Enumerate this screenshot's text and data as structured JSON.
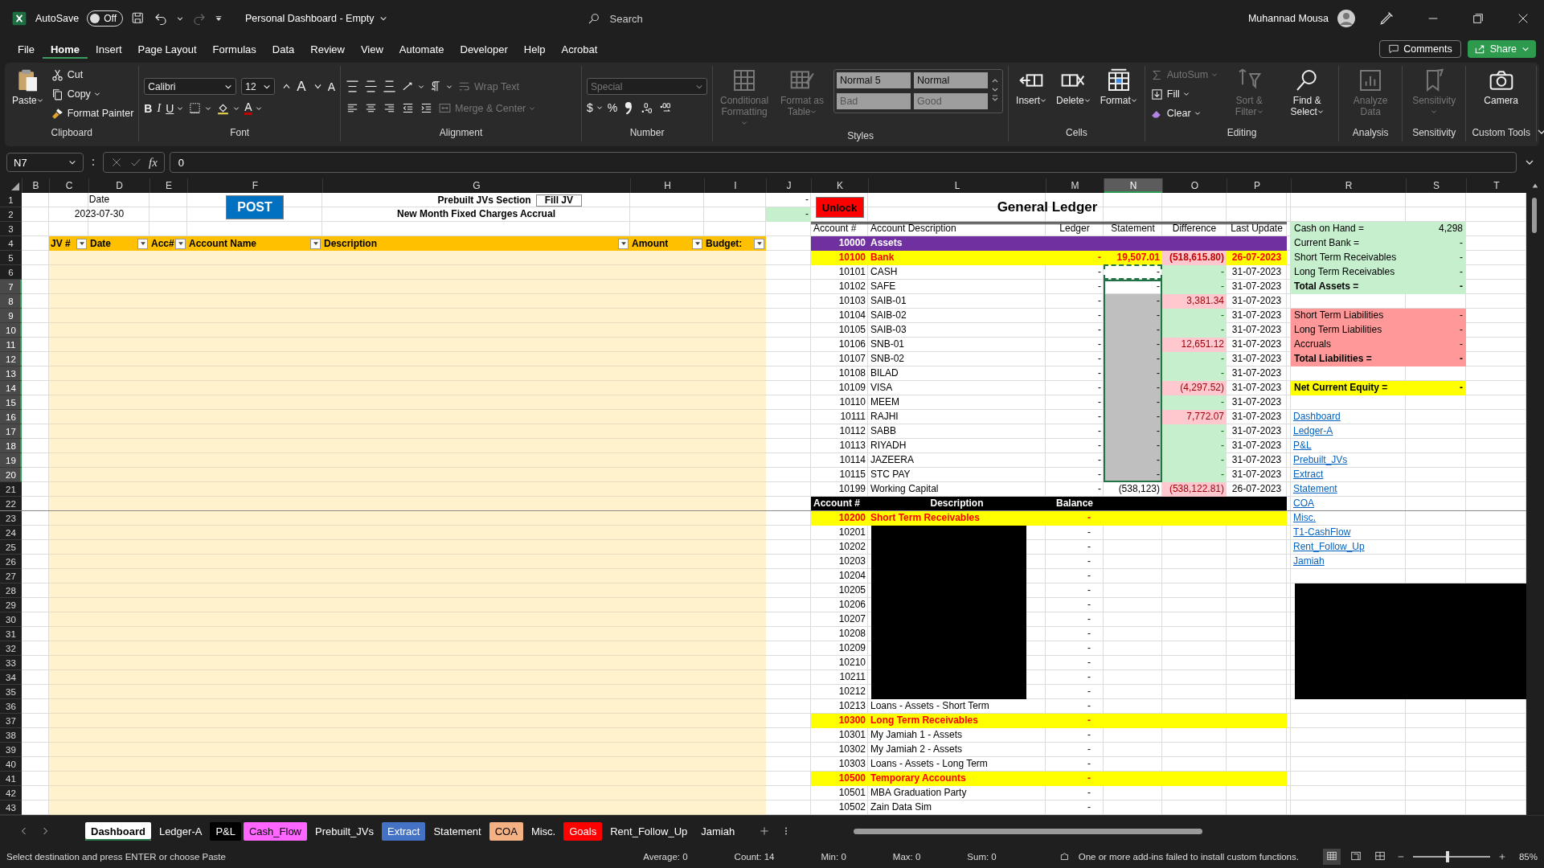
{
  "title_bar": {
    "autosave_label": "AutoSave",
    "autosave_on": false,
    "autosave_state": "Off",
    "title": "Personal Dashboard - Empty",
    "search_placeholder": "Search",
    "user_name": "Muhannad Mousa"
  },
  "menu_tabs": [
    {
      "label": "File",
      "selected": false
    },
    {
      "label": "Home",
      "selected": true
    },
    {
      "label": "Insert",
      "selected": false
    },
    {
      "label": "Page Layout",
      "selected": false
    },
    {
      "label": "Formulas",
      "selected": false
    },
    {
      "label": "Data",
      "selected": false
    },
    {
      "label": "Review",
      "selected": false
    },
    {
      "label": "View",
      "selected": false
    },
    {
      "label": "Automate",
      "selected": false
    },
    {
      "label": "Developer",
      "selected": false
    },
    {
      "label": "Help",
      "selected": false
    },
    {
      "label": "Acrobat",
      "selected": false
    }
  ],
  "comments_button": "Comments",
  "share_button": "Share",
  "ribbon": {
    "groups": [
      {
        "label": "Clipboard",
        "kind": "columns",
        "sets": [
          [
            {
              "kind": "large",
              "label": "Paste",
              "dropdown": true,
              "disabled": false
            }
          ],
          [
            {
              "kind": "small",
              "label": "Cut",
              "dropdown": false,
              "disabled": false
            },
            {
              "kind": "small",
              "label": "Copy",
              "dropdown": true,
              "disabled": false
            },
            {
              "kind": "small",
              "label": "Format Painter",
              "dropdown": false,
              "disabled": false
            }
          ]
        ]
      },
      {
        "label": "Font",
        "kind": "rows",
        "sets": [
          [
            {
              "kind": "combo",
              "label": "Calibri",
              "dropdown": true,
              "disabled": false
            },
            {
              "kind": "combo",
              "label": "12",
              "dropdown": true,
              "disabled": false
            },
            {
              "kind": "icon",
              "label": "A",
              "dropdown": false,
              "disabled": false
            },
            {
              "kind": "icon",
              "label": "A",
              "dropdown": false,
              "disabled": false
            }
          ],
          [
            {
              "kind": "icon",
              "label": "B",
              "dropdown": false,
              "disabled": false
            },
            {
              "kind": "icon",
              "label": "I",
              "dropdown": false,
              "disabled": false
            },
            {
              "kind": "icon",
              "label": "U",
              "dropdown": true,
              "disabled": false
            },
            {
              "kind": "icon",
              "dropdown": true,
              "disabled": false
            },
            {
              "kind": "icon",
              "dropdown": true,
              "disabled": false
            },
            {
              "kind": "icon",
              "label": "A",
              "dropdown": true,
              "disabled": false
            }
          ]
        ]
      },
      {
        "label": "Alignment",
        "kind": "rows",
        "sets": [
          [
            {
              "kind": "icon",
              "dropdown": false,
              "disabled": false
            },
            {
              "kind": "icon",
              "dropdown": false,
              "disabled": false
            },
            {
              "kind": "icon",
              "dropdown": false,
              "disabled": false
            },
            {
              "kind": "icon",
              "dropdown": true,
              "disabled": false
            },
            {
              "kind": "icon",
              "dropdown": true,
              "disabled": false
            },
            {
              "kind": "small",
              "label": "Wrap Text",
              "dropdown": false,
              "disabled": true
            }
          ],
          [
            {
              "kind": "icon",
              "dropdown": false,
              "disabled": false
            },
            {
              "kind": "icon",
              "dropdown": false,
              "disabled": false
            },
            {
              "kind": "icon",
              "dropdown": false,
              "disabled": false
            },
            {
              "kind": "icon",
              "dropdown": false,
              "disabled": false
            },
            {
              "kind": "icon",
              "dropdown": false,
              "disabled": false
            },
            {
              "kind": "small",
              "label": "Merge & Center",
              "dropdown": true,
              "disabled": true
            }
          ]
        ]
      },
      {
        "label": "Number",
        "kind": "rows",
        "sets": [
          [
            {
              "kind": "combo",
              "label": "Special",
              "dropdown": true,
              "disabled": true
            }
          ],
          [
            {
              "kind": "icon",
              "label": "$",
              "dropdown": true,
              "disabled": false
            },
            {
              "kind": "icon",
              "label": "%",
              "dropdown": false,
              "disabled": false
            },
            {
              "kind": "icon",
              "dropdown": false,
              "disabled": false
            },
            {
              "kind": "icon",
              "dropdown": false,
              "disabled": false
            },
            {
              "kind": "icon",
              "dropdown": false,
              "disabled": false
            }
          ]
        ]
      },
      {
        "label": "Styles",
        "kind": "columns",
        "sets": [
          [
            {
              "kind": "large",
              "label": "Conditional Formatting",
              "dropdown": true,
              "disabled": true
            }
          ],
          [
            {
              "kind": "large",
              "label": "Format as Table",
              "dropdown": true,
              "disabled": true
            }
          ],
          [
            {
              "kind": "gallery",
              "dropdown": false,
              "disabled": false,
              "items": [
                {
                  "label": "Normal 5",
                  "disabled": false
                },
                {
                  "label": "Normal",
                  "disabled": false
                },
                {
                  "label": "Bad",
                  "disabled": true
                },
                {
                  "label": "Good",
                  "disabled": true
                }
              ]
            }
          ]
        ]
      },
      {
        "label": "Cells",
        "kind": "columns",
        "sets": [
          [
            {
              "kind": "large",
              "label": "Insert",
              "dropdown": true,
              "disabled": false
            }
          ],
          [
            {
              "kind": "large",
              "label": "Delete",
              "dropdown": true,
              "disabled": false
            }
          ],
          [
            {
              "kind": "large",
              "label": "Format",
              "dropdown": true,
              "disabled": false
            }
          ]
        ]
      },
      {
        "label": "Editing",
        "kind": "columns",
        "sets": [
          [
            {
              "kind": "small",
              "label": "AutoSum",
              "dropdown": true,
              "disabled": true
            },
            {
              "kind": "small",
              "label": "Fill",
              "dropdown": true,
              "disabled": false
            },
            {
              "kind": "small",
              "label": "Clear",
              "dropdown": true,
              "disabled": false
            }
          ],
          [
            {
              "kind": "large",
              "label": "Sort & Filter",
              "dropdown": true,
              "disabled": true
            }
          ],
          [
            {
              "kind": "large",
              "label": "Find & Select",
              "dropdown": true,
              "disabled": false
            }
          ]
        ]
      },
      {
        "label": "Analysis",
        "kind": "columns",
        "sets": [
          [
            {
              "kind": "large",
              "label": "Analyze Data",
              "dropdown": false,
              "disabled": true
            }
          ]
        ]
      },
      {
        "label": "Sensitivity",
        "kind": "columns",
        "sets": [
          [
            {
              "kind": "large",
              "label": "Sensitivity",
              "dropdown": true,
              "disabled": true
            }
          ]
        ]
      },
      {
        "label": "Custom Tools",
        "kind": "columns",
        "sets": [
          [
            {
              "kind": "large",
              "label": "Camera",
              "dropdown": false,
              "disabled": false
            }
          ]
        ]
      }
    ]
  },
  "formula_bar": {
    "name_box": "N7",
    "function_label": "fx",
    "formula": "0"
  },
  "sheet": {
    "columns": [
      {
        "label": "B",
        "selected": false
      },
      {
        "label": "C",
        "selected": false
      },
      {
        "label": "D",
        "selected": false
      },
      {
        "label": "E",
        "selected": false
      },
      {
        "label": "F",
        "selected": false
      },
      {
        "label": "G",
        "selected": false
      },
      {
        "label": "H",
        "selected": false
      },
      {
        "label": "I",
        "selected": false
      },
      {
        "label": "J",
        "selected": false
      },
      {
        "label": "K",
        "selected": false
      },
      {
        "label": "L",
        "selected": false
      },
      {
        "label": "M",
        "selected": false
      },
      {
        "label": "N",
        "selected": true
      },
      {
        "label": "O",
        "selected": false
      },
      {
        "label": "P",
        "selected": false
      },
      {
        "label": "R",
        "selected": false
      },
      {
        "label": "S",
        "selected": false
      },
      {
        "label": "T",
        "selected": false
      }
    ],
    "row_numbers": [
      {
        "label": "1",
        "selected": false
      },
      {
        "label": "2",
        "selected": false
      },
      {
        "label": "3",
        "selected": false
      },
      {
        "label": "4",
        "selected": false
      },
      {
        "label": "5",
        "selected": false
      },
      {
        "label": "6",
        "selected": false
      },
      {
        "label": "7",
        "selected": true
      },
      {
        "label": "8",
        "selected": true
      },
      {
        "label": "9",
        "selected": true
      },
      {
        "label": "10",
        "selected": true
      },
      {
        "label": "11",
        "selected": true
      },
      {
        "label": "12",
        "selected": true
      },
      {
        "label": "13",
        "selected": true
      },
      {
        "label": "14",
        "selected": true
      },
      {
        "label": "15",
        "selected": true
      },
      {
        "label": "16",
        "selected": true
      },
      {
        "label": "17",
        "selected": true
      },
      {
        "label": "18",
        "selected": true
      },
      {
        "label": "19",
        "selected": true
      },
      {
        "label": "20",
        "selected": true
      },
      {
        "label": "21",
        "selected": false
      },
      {
        "label": "22",
        "selected": false
      },
      {
        "label": "23",
        "selected": false
      },
      {
        "label": "24",
        "selected": false
      },
      {
        "label": "25",
        "selected": false
      },
      {
        "label": "26",
        "selected": false
      },
      {
        "label": "27",
        "selected": false
      },
      {
        "label": "28",
        "selected": false
      },
      {
        "label": "29",
        "selected": false
      },
      {
        "label": "30",
        "selected": false
      },
      {
        "label": "31",
        "selected": false
      },
      {
        "label": "32",
        "selected": false
      },
      {
        "label": "33",
        "selected": false
      },
      {
        "label": "34",
        "selected": false
      },
      {
        "label": "35",
        "selected": false
      },
      {
        "label": "36",
        "selected": false
      },
      {
        "label": "37",
        "selected": false
      },
      {
        "label": "38",
        "selected": false
      },
      {
        "label": "39",
        "selected": false
      },
      {
        "label": "40",
        "selected": false
      },
      {
        "label": "41",
        "selected": false
      },
      {
        "label": "42",
        "selected": false
      },
      {
        "label": "43",
        "selected": false
      }
    ],
    "selection_shown": true,
    "copy_marquee_shown": true
  },
  "jv": {
    "date_label": "Date",
    "date_value": "2023-07-30",
    "post_button": "POST",
    "section_title": "Prebuilt JVs Section",
    "fill_button": "Fill JV",
    "subtitle": "New Month Fixed Charges Accrual",
    "status_values": [
      {
        "value": "-",
        "highlighted": false
      },
      {
        "value": "-",
        "highlighted": true
      }
    ],
    "headers": [
      "JV #",
      "Date",
      "Acc#",
      "Account Name",
      "Description",
      "Amount",
      "Budget:"
    ]
  },
  "ledger": {
    "unlock_button": "Unlock",
    "title": "General Ledger",
    "columns": [
      "Account #",
      "Account Description",
      "Ledger",
      "Statement",
      "Difference",
      "Last Update"
    ],
    "rows": [
      {
        "kind": "group",
        "account": "10000",
        "description": "Assets"
      },
      {
        "kind": "section",
        "account": "10100",
        "description": "Bank",
        "ledger": "-",
        "statement": "19,507.01",
        "statement_input": false,
        "difference": "(518,615.80)",
        "difference_ok": false,
        "last_update": "26-07-2023"
      },
      {
        "kind": "account",
        "account": "10101",
        "description": "CASH",
        "ledger": "-",
        "statement": "-",
        "statement_input": false,
        "difference": "-",
        "difference_ok": true,
        "last_update": "31-07-2023"
      },
      {
        "kind": "account",
        "account": "10102",
        "description": "SAFE",
        "ledger": "-",
        "statement": "-",
        "statement_input": false,
        "difference": "-",
        "difference_ok": true,
        "last_update": "31-07-2023"
      },
      {
        "kind": "account",
        "account": "10103",
        "description": "SAIB-01",
        "ledger": "-",
        "statement": "-",
        "statement_input": true,
        "difference": "3,381.34",
        "difference_ok": false,
        "last_update": "31-07-2023"
      },
      {
        "kind": "account",
        "account": "10104",
        "description": "SAIB-02",
        "ledger": "-",
        "statement": "-",
        "statement_input": true,
        "difference": "-",
        "difference_ok": true,
        "last_update": "31-07-2023"
      },
      {
        "kind": "account",
        "account": "10105",
        "description": "SAIB-03",
        "ledger": "-",
        "statement": "-",
        "statement_input": true,
        "difference": "-",
        "difference_ok": true,
        "last_update": "31-07-2023"
      },
      {
        "kind": "account",
        "account": "10106",
        "description": "SNB-01",
        "ledger": "-",
        "statement": "-",
        "statement_input": true,
        "difference": "12,651.12",
        "difference_ok": false,
        "last_update": "31-07-2023"
      },
      {
        "kind": "account",
        "account": "10107",
        "description": "SNB-02",
        "ledger": "-",
        "statement": "-",
        "statement_input": true,
        "difference": "-",
        "difference_ok": true,
        "last_update": "31-07-2023"
      },
      {
        "kind": "account",
        "account": "10108",
        "description": "BILAD",
        "ledger": "-",
        "statement": "-",
        "statement_input": true,
        "difference": "-",
        "difference_ok": true,
        "last_update": "31-07-2023"
      },
      {
        "kind": "account",
        "account": "10109",
        "description": "VISA",
        "ledger": "-",
        "statement": "-",
        "statement_input": true,
        "difference": "(4,297.52)",
        "difference_ok": false,
        "last_update": "31-07-2023"
      },
      {
        "kind": "account",
        "account": "10110",
        "description": "MEEM",
        "ledger": "-",
        "statement": "-",
        "statement_input": true,
        "difference": "-",
        "difference_ok": true,
        "last_update": "31-07-2023"
      },
      {
        "kind": "account",
        "account": "10111",
        "description": "RAJHI",
        "ledger": "-",
        "statement": "-",
        "statement_input": true,
        "difference": "7,772.07",
        "difference_ok": false,
        "last_update": "31-07-2023"
      },
      {
        "kind": "account",
        "account": "10112",
        "description": "SABB",
        "ledger": "-",
        "statement": "-",
        "statement_input": true,
        "difference": "-",
        "difference_ok": true,
        "last_update": "31-07-2023"
      },
      {
        "kind": "account",
        "account": "10113",
        "description": "RIYADH",
        "ledger": "-",
        "statement": "-",
        "statement_input": true,
        "difference": "-",
        "difference_ok": true,
        "last_update": "31-07-2023"
      },
      {
        "kind": "account",
        "account": "10114",
        "description": "JAZEERA",
        "ledger": "-",
        "statement": "-",
        "statement_input": true,
        "difference": "-",
        "difference_ok": true,
        "last_update": "31-07-2023"
      },
      {
        "kind": "account",
        "account": "10115",
        "description": "STC PAY",
        "ledger": "-",
        "statement": "-",
        "statement_input": true,
        "difference": "-",
        "difference_ok": true,
        "last_update": "31-07-2023"
      },
      {
        "kind": "account",
        "account": "10199",
        "description": "Working Capital",
        "ledger": "-",
        "statement": "(538,123)",
        "statement_input": false,
        "difference": "(538,122.81)",
        "difference_ok": false,
        "last_update": "26-07-2023"
      }
    ]
  },
  "balances": {
    "columns": [
      "Account #",
      "Description",
      "Balance"
    ],
    "rows": [
      {
        "kind": "section",
        "account": "10200",
        "description": "Short Term Receivables",
        "balance": "-",
        "redacted": false
      },
      {
        "kind": "account",
        "account": "10201",
        "balance": "-",
        "redacted": true
      },
      {
        "kind": "account",
        "account": "10202",
        "balance": "-",
        "redacted": true
      },
      {
        "kind": "account",
        "account": "10203",
        "balance": "-",
        "redacted": true
      },
      {
        "kind": "account",
        "account": "10204",
        "balance": "-",
        "redacted": true
      },
      {
        "kind": "account",
        "account": "10205",
        "balance": "-",
        "redacted": true
      },
      {
        "kind": "account",
        "account": "10206",
        "balance": "-",
        "redacted": true
      },
      {
        "kind": "account",
        "account": "10207",
        "balance": "-",
        "redacted": true
      },
      {
        "kind": "account",
        "account": "10208",
        "balance": "-",
        "redacted": true
      },
      {
        "kind": "account",
        "account": "10209",
        "balance": "-",
        "redacted": true
      },
      {
        "kind": "account",
        "account": "10210",
        "balance": "-",
        "redacted": true
      },
      {
        "kind": "account",
        "account": "10211",
        "balance": "-",
        "redacted": true
      },
      {
        "kind": "account",
        "account": "10212",
        "balance": "-",
        "redacted": true
      },
      {
        "kind": "account",
        "account": "10213",
        "description": "Loans - Assets - Short Term",
        "balance": "-",
        "redacted": false
      },
      {
        "kind": "section",
        "account": "10300",
        "description": "Long Term Receivables",
        "balance": "-",
        "redacted": false
      },
      {
        "kind": "account",
        "account": "10301",
        "description": "My Jamiah 1 - Assets",
        "balance": "-",
        "redacted": false
      },
      {
        "kind": "account",
        "account": "10302",
        "description": "My Jamiah 2 - Assets",
        "balance": "-",
        "redacted": false
      },
      {
        "kind": "account",
        "account": "10303",
        "description": "Loans - Assets - Long Term",
        "balance": "-",
        "redacted": false
      },
      {
        "kind": "section",
        "account": "10500",
        "description": "Temporary Accounts",
        "balance": "-",
        "redacted": false
      },
      {
        "kind": "account",
        "account": "10501",
        "description": "MBA Graduation Party",
        "balance": "-",
        "redacted": false
      },
      {
        "kind": "account",
        "account": "10502",
        "description": "Zain Data Sim",
        "balance": "-",
        "redacted": false
      }
    ]
  },
  "summary": {
    "items": [
      {
        "kind": "assets",
        "label": "Cash on Hand =",
        "value": "4,298",
        "total": false
      },
      {
        "kind": "assets",
        "label": "Current Bank =",
        "value": "-",
        "total": false
      },
      {
        "kind": "assets",
        "label": "Short Term Receivables",
        "value": "-",
        "total": false
      },
      {
        "kind": "assets",
        "label": "Long Term Receivables",
        "value": "-",
        "total": false
      },
      {
        "kind": "assets",
        "label": "Total Assets =",
        "value": "-",
        "total": true
      },
      {
        "kind": "liabilities",
        "label": "Short Term Liabilities",
        "value": "-",
        "total": false
      },
      {
        "kind": "liabilities",
        "label": "Long Term Liabilities",
        "value": "-",
        "total": false
      },
      {
        "kind": "liabilities",
        "label": "Accruals",
        "value": "-",
        "total": false
      },
      {
        "kind": "liabilities",
        "label": "Total Liabilities =",
        "value": "-",
        "total": true
      },
      {
        "kind": "equity",
        "label": "Net Current Equity =",
        "value": "-",
        "total": true
      }
    ],
    "links": [
      "Dashboard",
      "Ledger-A",
      "P&L",
      "Prebuilt_JVs",
      "Extract",
      "Statement",
      "COA",
      "Misc.",
      "T1-CashFlow",
      "Rent_Follow_Up",
      "Jamiah"
    ],
    "redaction": true
  },
  "sheet_tabs": [
    {
      "label": "Dashboard",
      "selected": true
    },
    {
      "label": "Ledger-A",
      "selected": false
    },
    {
      "label": "P&L",
      "selected": false,
      "color": "#000000"
    },
    {
      "label": "Cash_Flow",
      "selected": false,
      "color": "#ff66ff"
    },
    {
      "label": "Prebuilt_JVs",
      "selected": false
    },
    {
      "label": "Extract",
      "selected": false,
      "color": "#4472c4"
    },
    {
      "label": "Statement",
      "selected": false
    },
    {
      "label": "COA",
      "selected": false,
      "color": "#f4b183"
    },
    {
      "label": "Misc.",
      "selected": false
    },
    {
      "label": "Goals",
      "selected": false,
      "color": "#ff0000"
    },
    {
      "label": "Rent_Follow_Up",
      "selected": false
    },
    {
      "label": "Jamiah",
      "selected": false
    }
  ],
  "status_bar": {
    "message": "Select destination and press ENTER or choose Paste",
    "stats": [
      "Average: 0",
      "Count: 14",
      "Min: 0",
      "Max: 0",
      "Sum: 0"
    ],
    "addin_warning": "One or more add-ins failed to install custom functions.",
    "views": [
      {
        "selected": true
      },
      {
        "selected": false
      },
      {
        "selected": false
      }
    ],
    "zoom": {
      "level": 0.45
    },
    "zoom_label": "85%"
  }
}
